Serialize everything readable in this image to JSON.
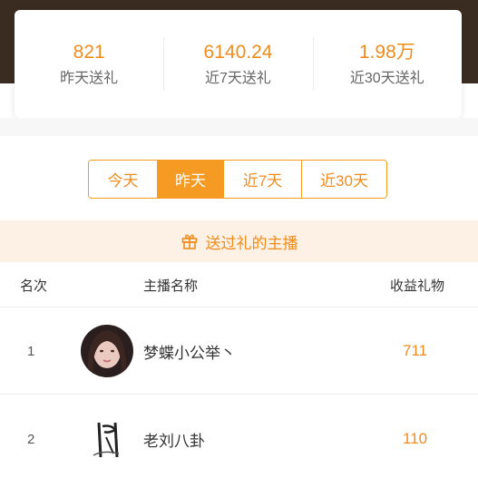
{
  "stats": [
    {
      "value": "821",
      "label": "昨天送礼"
    },
    {
      "value": "6140.24",
      "label": "近7天送礼"
    },
    {
      "value": "1.98万",
      "label": "近30天送礼"
    }
  ],
  "tabs": [
    {
      "label": "今天",
      "active": false
    },
    {
      "label": "昨天",
      "active": true
    },
    {
      "label": "近7天",
      "active": false
    },
    {
      "label": "近30天",
      "active": false
    }
  ],
  "section": {
    "title": "送过礼的主播",
    "icon": "gift-icon"
  },
  "table": {
    "headers": {
      "rank": "名次",
      "name": "主播名称",
      "gift": "收益礼物"
    },
    "rows": [
      {
        "rank": "1",
        "name": "梦蝶小公举丶",
        "gift": "711"
      },
      {
        "rank": "2",
        "name": "老刘八卦",
        "gift": "110"
      }
    ]
  },
  "colors": {
    "accent": "#f59a23",
    "accent_text": "#f08c1e",
    "header_bg": "#fdf0e4",
    "top_band": "#3a2c20"
  }
}
